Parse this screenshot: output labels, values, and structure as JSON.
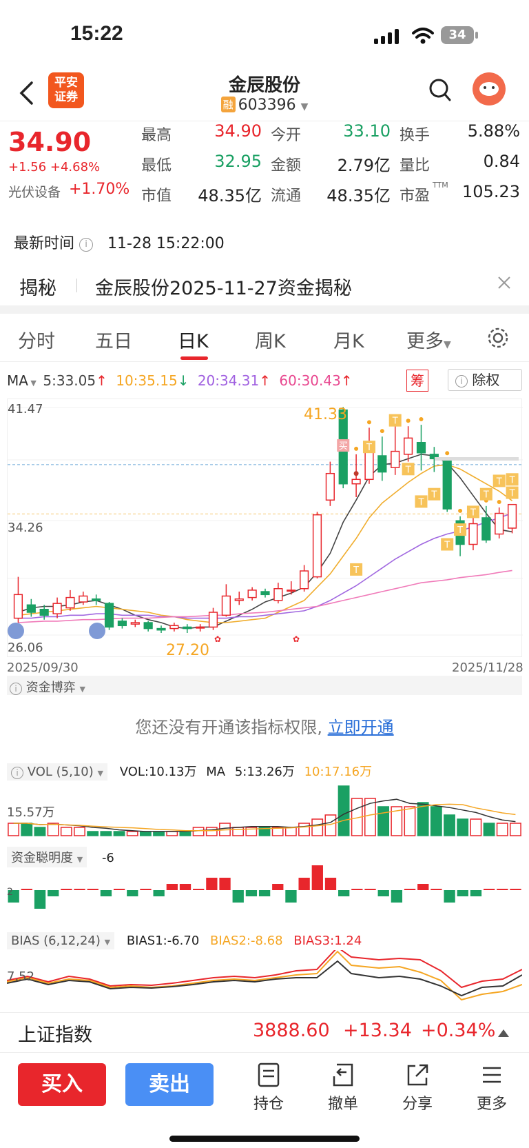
{
  "status": {
    "time": "15:22",
    "battery": "34"
  },
  "nav": {
    "title": "金辰股份",
    "rong_badge": "融",
    "code": "603396",
    "broker_logo": "平安\n证券"
  },
  "quote": {
    "price": "34.90",
    "change": "+1.56 +4.68%",
    "sector": "光伏设备",
    "sector_change": "+1.70%",
    "high_label": "最高",
    "high": "34.90",
    "open_label": "今开",
    "open": "33.10",
    "turnover_label": "换手",
    "turnover": "5.88%",
    "low_label": "最低",
    "low": "32.95",
    "amount_label": "金额",
    "amount": "2.79亿",
    "volratio_label": "量比",
    "volratio": "0.84",
    "mcap_label": "市值",
    "mcap": "48.35亿",
    "float_label": "流通",
    "float": "48.35亿",
    "pe_label": "市盈",
    "pe_sup": "TTM",
    "pe": "105.23"
  },
  "update": {
    "label": "最新时间",
    "time": "11-28 15:22:00"
  },
  "reveal": {
    "label": "揭秘",
    "text": "金辰股份2025-11-27资金揭秘"
  },
  "tabs": [
    "分时",
    "五日",
    "日K",
    "周K",
    "月K",
    "更多"
  ],
  "ma": {
    "label": "MA",
    "ma5": "5:33.05",
    "ma10": "10:35.15",
    "ma20": "20:34.31",
    "ma60": "60:30.43",
    "chip": "筹",
    "exright": "除权"
  },
  "chart_data": {
    "type": "candlestick",
    "y_max_label": "41.47",
    "y_ref_label": "34.26",
    "y_min_label": "26.06",
    "peak_label": "41.33",
    "low_label": "27.20",
    "x_start": "2025/09/30",
    "x_end": "2025/11/28",
    "ylim": [
      26.06,
      41.47
    ],
    "buy_marker": "买",
    "t_marker": "T",
    "candles": [
      {
        "o": 27.2,
        "c": 28.8,
        "h": 30.0,
        "l": 26.9
      },
      {
        "o": 28.1,
        "c": 27.6,
        "h": 28.5,
        "l": 27.3
      },
      {
        "o": 27.8,
        "c": 27.4,
        "h": 28.1,
        "l": 27.1
      },
      {
        "o": 27.5,
        "c": 28.2,
        "h": 28.6,
        "l": 27.2
      },
      {
        "o": 27.9,
        "c": 28.6,
        "h": 29.1,
        "l": 27.7
      },
      {
        "o": 28.3,
        "c": 28.7,
        "h": 29.0,
        "l": 28.1
      },
      {
        "o": 28.5,
        "c": 28.4,
        "h": 28.8,
        "l": 28.1
      },
      {
        "o": 28.2,
        "c": 26.6,
        "h": 28.3,
        "l": 26.4
      },
      {
        "o": 27.0,
        "c": 26.7,
        "h": 27.2,
        "l": 26.5
      },
      {
        "o": 26.8,
        "c": 26.9,
        "h": 27.1,
        "l": 26.6
      },
      {
        "o": 26.9,
        "c": 26.5,
        "h": 27.0,
        "l": 26.3
      },
      {
        "o": 26.5,
        "c": 26.4,
        "h": 26.7,
        "l": 26.2
      },
      {
        "o": 26.5,
        "c": 26.7,
        "h": 26.9,
        "l": 26.3
      },
      {
        "o": 26.6,
        "c": 26.5,
        "h": 26.8,
        "l": 26.2
      },
      {
        "o": 26.6,
        "c": 26.6,
        "h": 26.8,
        "l": 26.3
      },
      {
        "o": 26.6,
        "c": 27.6,
        "h": 27.9,
        "l": 26.4
      },
      {
        "o": 27.4,
        "c": 28.7,
        "h": 29.5,
        "l": 27.3
      },
      {
        "o": 28.4,
        "c": 28.5,
        "h": 29.0,
        "l": 28.1
      },
      {
        "o": 28.6,
        "c": 29.1,
        "h": 29.3,
        "l": 28.4
      },
      {
        "o": 29.0,
        "c": 28.8,
        "h": 29.2,
        "l": 28.6
      },
      {
        "o": 28.4,
        "c": 29.2,
        "h": 29.6,
        "l": 28.2
      },
      {
        "o": 29.1,
        "c": 29.1,
        "h": 29.7,
        "l": 28.8
      },
      {
        "o": 29.2,
        "c": 30.4,
        "h": 30.8,
        "l": 29.0
      },
      {
        "o": 30.0,
        "c": 34.2,
        "h": 34.4,
        "l": 29.9
      },
      {
        "o": 35.2,
        "c": 37.0,
        "h": 37.8,
        "l": 34.8
      },
      {
        "o": 41.3,
        "c": 36.3,
        "h": 41.5,
        "l": 36.0
      },
      {
        "o": 36.3,
        "c": 36.6,
        "h": 38.3,
        "l": 35.4
      },
      {
        "o": 36.6,
        "c": 38.5,
        "h": 40.1,
        "l": 36.3
      },
      {
        "o": 38.2,
        "c": 37.1,
        "h": 39.5,
        "l": 36.5
      },
      {
        "o": 37.4,
        "c": 38.5,
        "h": 40.5,
        "l": 36.9
      },
      {
        "o": 38.3,
        "c": 39.4,
        "h": 40.2,
        "l": 37.8
      },
      {
        "o": 39.1,
        "c": 38.4,
        "h": 40.3,
        "l": 37.2
      },
      {
        "o": 38.3,
        "c": 38.0,
        "h": 38.8,
        "l": 37.1
      },
      {
        "o": 37.9,
        "c": 34.6,
        "h": 38.0,
        "l": 34.4
      },
      {
        "o": 33.8,
        "c": 32.2,
        "h": 34.1,
        "l": 31.4
      },
      {
        "o": 32.2,
        "c": 33.6,
        "h": 34.2,
        "l": 31.8
      },
      {
        "o": 34.0,
        "c": 32.5,
        "h": 34.8,
        "l": 32.3
      },
      {
        "o": 32.9,
        "c": 34.3,
        "h": 34.7,
        "l": 32.6
      },
      {
        "o": 33.3,
        "c": 34.9,
        "h": 34.9,
        "l": 32.95
      }
    ],
    "series": [
      {
        "name": "MA5",
        "color": "#444",
        "values": [
          27.6,
          27.9,
          28.0,
          28.0,
          28.1,
          28.3,
          28.4,
          28.1,
          27.8,
          27.4,
          27.1,
          26.9,
          26.6,
          26.5,
          26.6,
          26.6,
          27.0,
          27.4,
          27.8,
          28.3,
          28.6,
          28.9,
          29.3,
          30.3,
          31.6,
          33.7,
          35.2,
          36.8,
          37.6,
          37.7,
          38.0,
          38.3,
          38.2,
          37.7,
          36.7,
          35.5,
          34.3,
          33.2,
          33.05
        ]
      },
      {
        "name": "MA10",
        "color": "#f0ad2e",
        "values": [
          27.4,
          27.5,
          27.6,
          27.7,
          27.8,
          27.9,
          28.0,
          27.9,
          27.8,
          27.7,
          27.6,
          27.4,
          27.3,
          27.1,
          27.0,
          26.9,
          26.9,
          27.0,
          27.1,
          27.2,
          27.6,
          28.0,
          28.4,
          29.3,
          30.2,
          31.4,
          32.6,
          34.0,
          35.0,
          35.7,
          36.4,
          37.0,
          37.5,
          37.6,
          37.3,
          36.8,
          36.3,
          35.8,
          35.15
        ]
      },
      {
        "name": "MA20",
        "color": "#a067e0",
        "values": [
          27.2,
          27.2,
          27.3,
          27.3,
          27.4,
          27.4,
          27.5,
          27.5,
          27.4,
          27.4,
          27.4,
          27.3,
          27.3,
          27.2,
          27.2,
          27.2,
          27.2,
          27.3,
          27.3,
          27.4,
          27.5,
          27.6,
          27.7,
          28.0,
          28.4,
          28.9,
          29.4,
          30.0,
          30.6,
          31.2,
          31.7,
          32.2,
          32.6,
          32.9,
          33.1,
          33.4,
          33.7,
          34.0,
          34.31
        ]
      },
      {
        "name": "MA60",
        "color": "#f07ab9",
        "values": [
          26.9,
          26.95,
          27.0,
          27.0,
          27.05,
          27.1,
          27.1,
          27.15,
          27.2,
          27.2,
          27.2,
          27.25,
          27.3,
          27.3,
          27.35,
          27.4,
          27.4,
          27.5,
          27.55,
          27.6,
          27.7,
          27.8,
          27.9,
          28.0,
          28.2,
          28.4,
          28.6,
          28.8,
          29.0,
          29.2,
          29.4,
          29.6,
          29.7,
          29.8,
          29.95,
          30.05,
          30.15,
          30.3,
          30.43
        ]
      }
    ]
  },
  "fund": {
    "label": "资金博弈",
    "notice": "您还没有开通该指标权限,",
    "link": "立即开通"
  },
  "vol": {
    "label": "VOL (5,10)",
    "vol": "VOL:10.13万",
    "ma_label": "MA",
    "ma5": "5:13.26万",
    "ma10": "10:17.16万",
    "axis": "15.57万",
    "values": [
      3,
      3,
      2,
      3,
      2,
      2,
      1,
      1,
      1,
      1,
      1,
      1,
      1,
      1,
      2,
      2,
      3,
      2,
      2,
      2,
      2,
      2,
      3,
      4,
      5,
      12,
      9,
      9,
      7,
      7,
      7,
      8,
      7,
      5,
      4,
      4,
      3,
      3,
      3
    ]
  },
  "smart": {
    "label": "资金聪明度",
    "value": "-6",
    "axis": "2",
    "values": [
      -2,
      0,
      -3,
      -1,
      0,
      0,
      0,
      -1,
      0,
      -1,
      0,
      -1,
      1,
      1,
      0,
      2,
      2,
      -2,
      -1,
      -1,
      1,
      -2,
      2,
      4,
      2,
      -1,
      0,
      0,
      -1,
      -2,
      0,
      1,
      0,
      -2,
      -1,
      -1,
      0,
      0,
      0
    ]
  },
  "bias": {
    "label": "BIAS (6,12,24)",
    "b1": "BIAS1:-6.70",
    "b2": "BIAS2:-8.68",
    "b3": "BIAS3:1.24",
    "axis": "7.52"
  },
  "index": {
    "name": "上证指数",
    "value": "3888.60",
    "change": "+13.34",
    "pct": "+0.34%"
  },
  "toolbar": {
    "buy": "买入",
    "sell": "卖出",
    "hold": "持仓",
    "cancel": "撤单",
    "share": "分享",
    "more": "更多"
  }
}
